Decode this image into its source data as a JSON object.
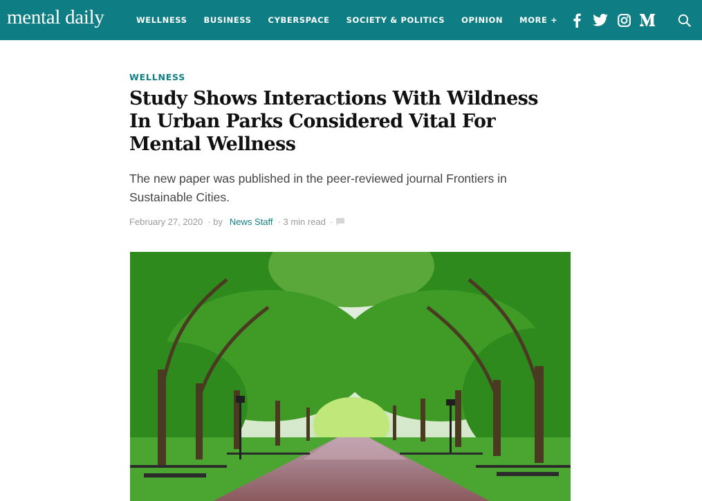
{
  "header": {
    "logo": "mental daily",
    "nav": [
      {
        "label": "WELLNESS"
      },
      {
        "label": "BUSINESS"
      },
      {
        "label": "CYBERSPACE"
      },
      {
        "label": "SOCIETY & POLITICS"
      },
      {
        "label": "OPINION"
      },
      {
        "label": "MORE +"
      }
    ],
    "social_icons": [
      "facebook-icon",
      "twitter-icon",
      "instagram-icon",
      "medium-icon"
    ],
    "search_icon": "search-icon",
    "bar_color": "#0f7e84"
  },
  "article": {
    "category": "WELLNESS",
    "title": "Study Shows Interactions With Wildness In Urban Parks Considered Vital For Mental Wellness",
    "subtitle": "The new paper was published in the peer-reviewed journal Frontiers in Sustainable Cities.",
    "meta": {
      "date": "February 27, 2020",
      "by": "· by",
      "author": "News Staff",
      "read_time": "· 3 min read",
      "trail": "·",
      "comment_icon": "comment-icon"
    },
    "accent_color": "#0f7e84"
  },
  "hero_image": {
    "description_icon": "park-photo"
  }
}
